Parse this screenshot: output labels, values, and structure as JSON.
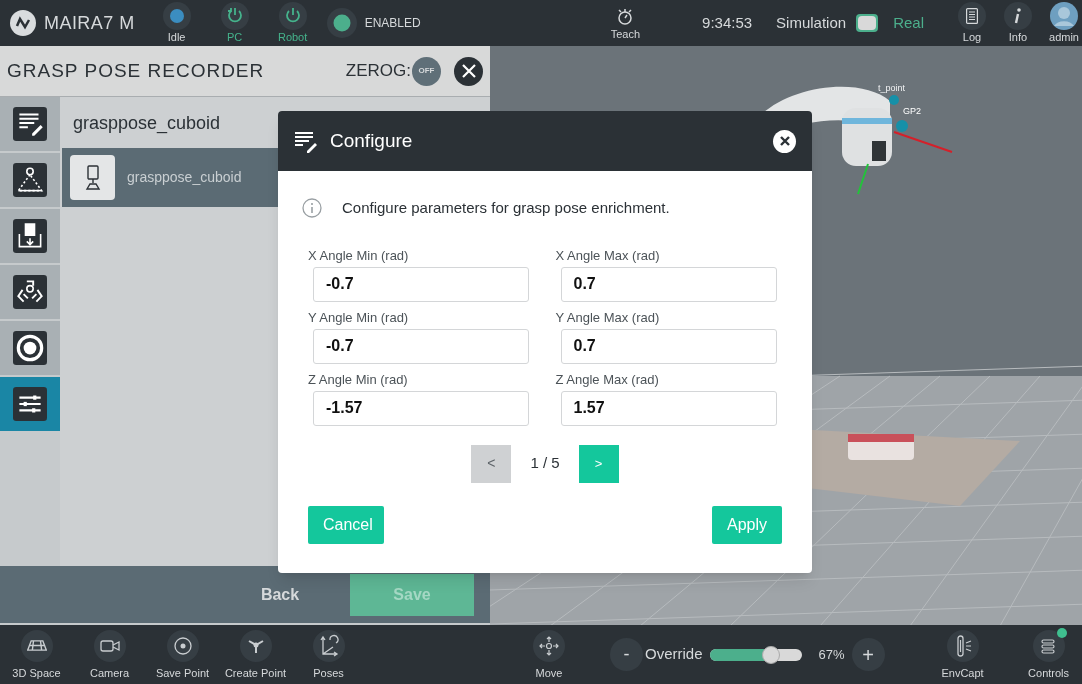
{
  "top_bar": {
    "logo": "MAIRA7 M",
    "status_items": [
      {
        "kind": "dot",
        "label": "Idle",
        "color": "#3b8dc0"
      },
      {
        "kind": "restart",
        "label": "PC",
        "color": "#45b38c"
      },
      {
        "kind": "power",
        "label": "Robot",
        "color": "#45b38c"
      }
    ],
    "enabled": {
      "label": "ENABLED",
      "color": "#4caf8c"
    },
    "teach": {
      "label": "Teach"
    },
    "time": "9:34:53",
    "mode_switch": {
      "left": "Simulation",
      "right": "Real",
      "on": true
    },
    "right_items": [
      {
        "kind": "log",
        "label": "Log"
      },
      {
        "kind": "info",
        "label": "Info"
      },
      {
        "kind": "avatar",
        "label": "admin"
      }
    ]
  },
  "panel": {
    "title": "GRASP POSE RECORDER",
    "zerog": {
      "label": "ZEROG:",
      "state": "OFF",
      "on": false
    },
    "tools": [
      {
        "kind": "edit",
        "selected": false
      },
      {
        "kind": "scan",
        "selected": false
      },
      {
        "kind": "import",
        "selected": false
      },
      {
        "kind": "gripper",
        "selected": false
      },
      {
        "kind": "target",
        "selected": false
      },
      {
        "kind": "sliders",
        "selected": true
      }
    ],
    "list_title": "grasppose_cuboid",
    "items": [
      {
        "label": "grasppose_cuboid",
        "selected": true
      }
    ],
    "buttons": [
      {
        "label": "Back",
        "disabled": false
      },
      {
        "label": "Save",
        "disabled": true
      }
    ]
  },
  "dialog": {
    "title": "Configure",
    "info": "Configure parameters for grasp pose enrichment.",
    "fields": [
      {
        "label": "X Angle Min (rad)",
        "value": "-0.7"
      },
      {
        "label": "X Angle Max (rad)",
        "value": "0.7"
      },
      {
        "label": "Y Angle Min (rad)",
        "value": "-0.7"
      },
      {
        "label": "Y Angle Max (rad)",
        "value": "0.7"
      },
      {
        "label": "Z Angle Min (rad)",
        "value": "-1.57"
      },
      {
        "label": "Z Angle Max (rad)",
        "value": "1.57"
      }
    ],
    "pagination": {
      "prev": "<",
      "prev_disabled": true,
      "page": "1 / 5",
      "next": ">",
      "next_disabled": false
    },
    "buttons": [
      {
        "label": "Cancel"
      },
      {
        "label": "Apply"
      }
    ]
  },
  "viewport": {
    "scene_labels": [
      "t_point",
      "GP2"
    ]
  },
  "bottom_bar": {
    "left_items": [
      {
        "kind": "grid",
        "label": "3D Space"
      },
      {
        "kind": "camera",
        "label": "Camera"
      },
      {
        "kind": "savepoint",
        "label": "Save Point"
      },
      {
        "kind": "createpoint",
        "label": "Create Point"
      },
      {
        "kind": "poses",
        "label": "Poses"
      }
    ],
    "move": {
      "kind": "move",
      "label": "Move"
    },
    "override": {
      "minus": "-",
      "label": "Override",
      "level": 0.67,
      "reading": "67%",
      "plus": "+"
    },
    "right_items": [
      {
        "kind": "envcapt",
        "label": "EnvCapt",
        "badge": false
      },
      {
        "kind": "controls",
        "label": "Controls",
        "badge": true
      }
    ]
  }
}
